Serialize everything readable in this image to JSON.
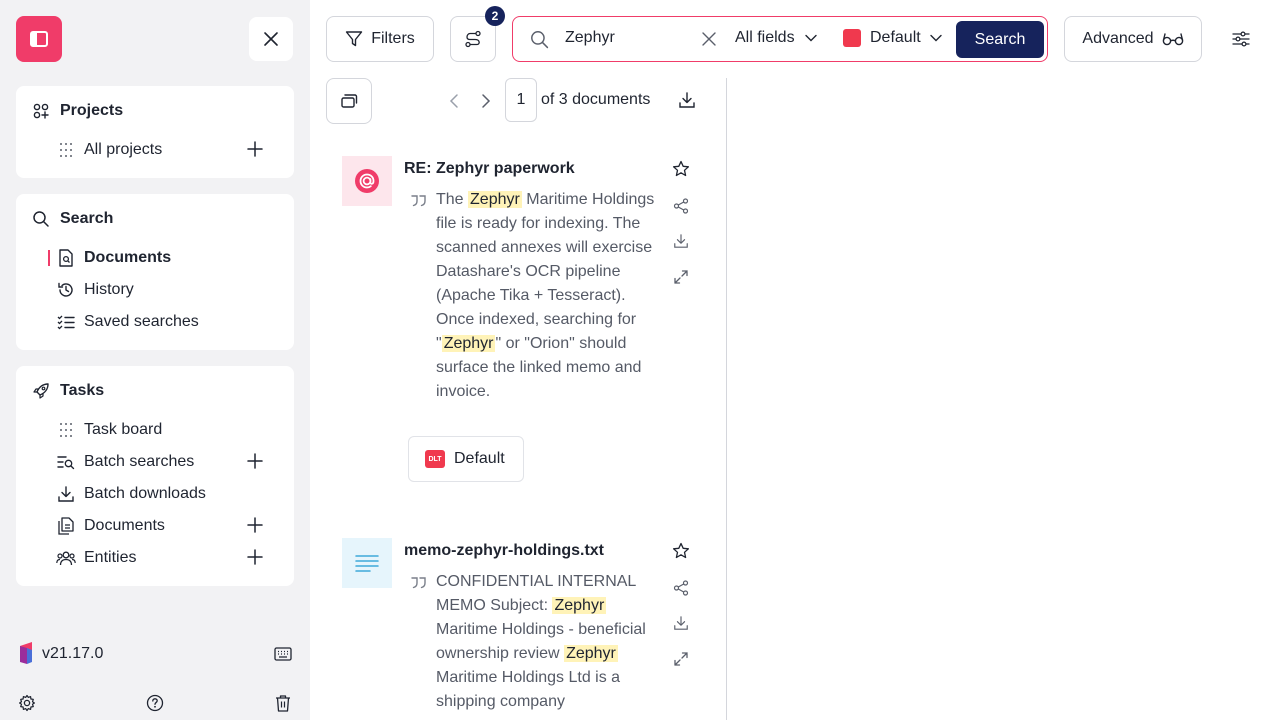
{
  "sidebar": {
    "projects": {
      "title": "Projects",
      "items": [
        {
          "label": "All projects"
        }
      ]
    },
    "search": {
      "title": "Search",
      "items": [
        {
          "label": "Documents"
        },
        {
          "label": "History"
        },
        {
          "label": "Saved searches"
        }
      ]
    },
    "tasks": {
      "title": "Tasks",
      "items": [
        {
          "label": "Task board"
        },
        {
          "label": "Batch searches"
        },
        {
          "label": "Batch downloads"
        },
        {
          "label": "Documents"
        },
        {
          "label": "Entities"
        }
      ]
    },
    "version": "v21.17.0"
  },
  "toolbar": {
    "filters_label": "Filters",
    "filter_badge": "2",
    "search_query": "Zephyr",
    "field_select": "All fields",
    "project_select": "Default",
    "search_button": "Search",
    "advanced_label": "Advanced"
  },
  "pagination": {
    "current_page": "1",
    "of_text": "of 3 documents"
  },
  "documents": [
    {
      "title": "RE: Zephyr paperwork",
      "excerpt": [
        {
          "t": "The "
        },
        {
          "t": "Zephyr",
          "hl": true
        },
        {
          "t": " Maritime Holdings file is ready for indexing. The scanned annexes will exercise Datashare's OCR pipeline (Apache Tika + Tesseract). Once indexed, searching for \""
        },
        {
          "t": "Zephyr",
          "hl": true
        },
        {
          "t": "\" or \"Orion\" should surface the linked memo and invoice."
        }
      ],
      "project_chip": "Default",
      "chip_badge": "DLT",
      "type_icon": "at-sign-icon"
    },
    {
      "title": "memo-zephyr-holdings.txt",
      "excerpt": [
        {
          "t": "CONFIDENTIAL INTERNAL MEMO Subject: "
        },
        {
          "t": "Zephyr",
          "hl": true
        },
        {
          "t": " Maritime Holdings - beneficial ownership review "
        },
        {
          "t": "Zephyr",
          "hl": true
        },
        {
          "t": " Maritime Holdings Ltd is a shipping company"
        }
      ],
      "type_icon": "text-file-icon"
    }
  ],
  "colors": {
    "accent": "#f03c69",
    "primary": "#16235c",
    "highlight": "#fff3b8",
    "project": "#f0394e"
  }
}
